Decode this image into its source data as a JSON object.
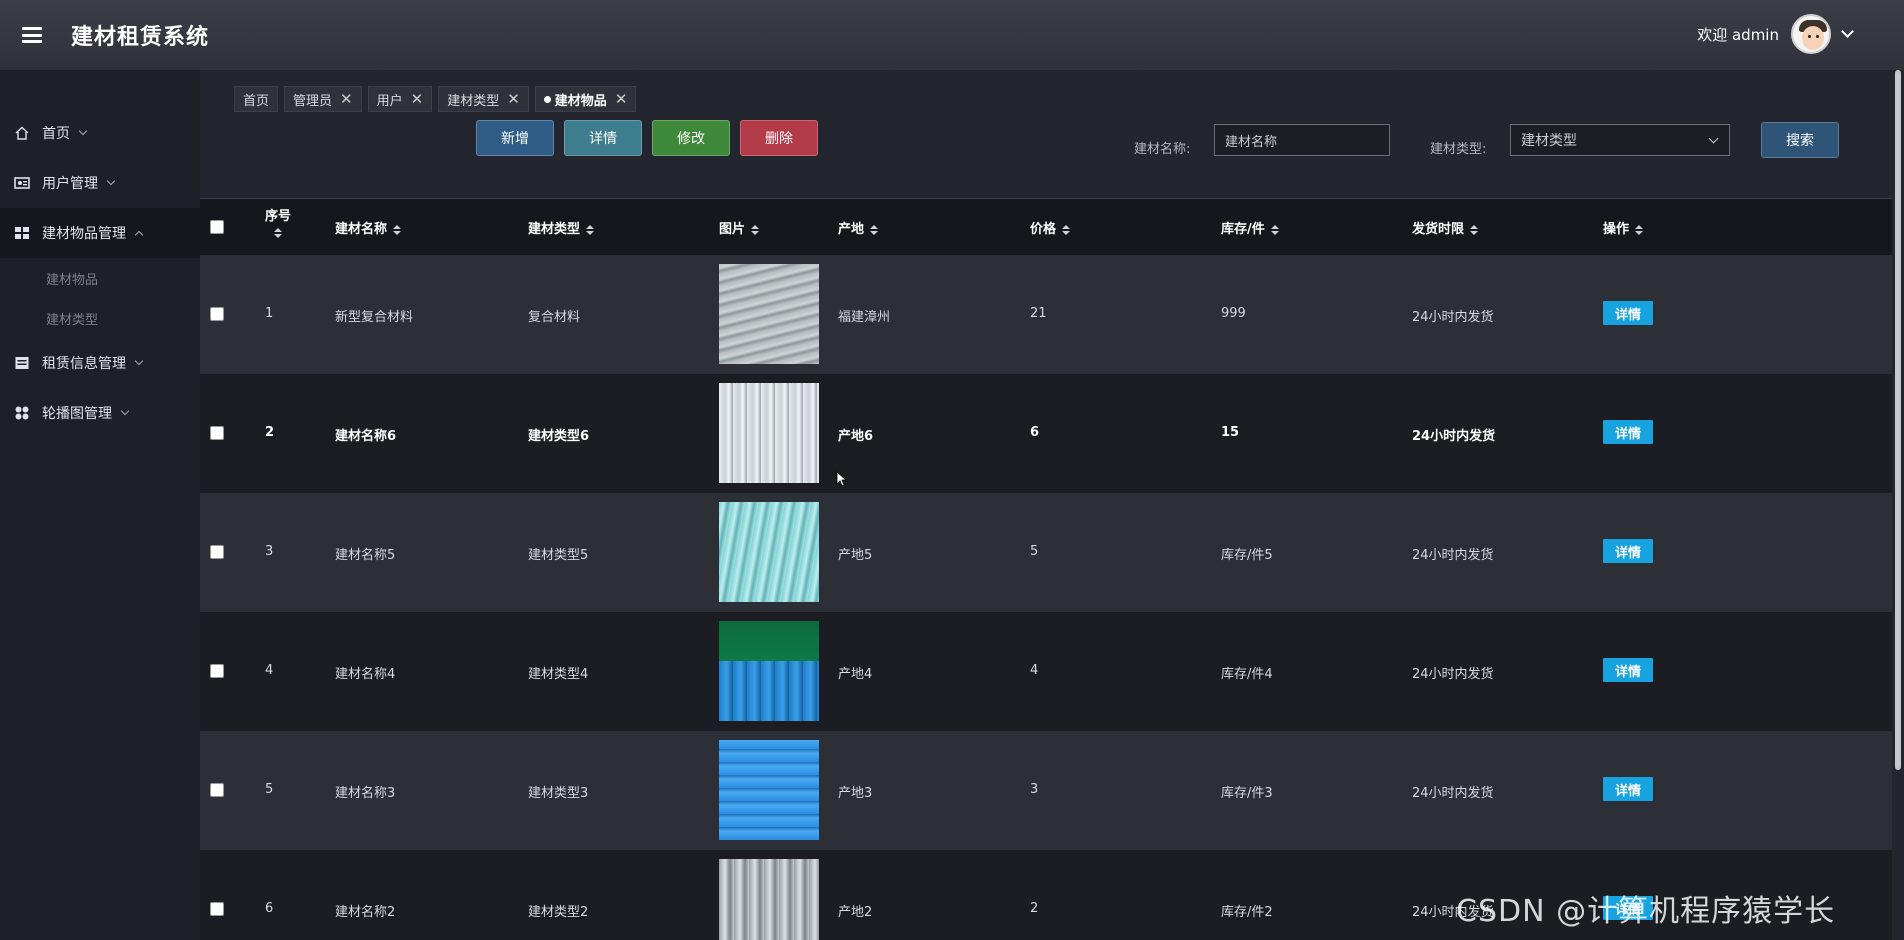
{
  "app": {
    "title": "建材租赁系统"
  },
  "user": {
    "welcome": "欢迎 admin"
  },
  "sidebar": {
    "items": [
      {
        "label": "首页",
        "icon": "home-icon"
      },
      {
        "label": "用户管理",
        "icon": "id-card-icon"
      },
      {
        "label": "建材物品管理",
        "icon": "grid-icon",
        "expanded": true,
        "children": [
          {
            "label": "建材物品"
          },
          {
            "label": "建材类型"
          }
        ]
      },
      {
        "label": "租赁信息管理",
        "icon": "document-icon"
      },
      {
        "label": "轮播图管理",
        "icon": "apps-icon"
      }
    ]
  },
  "tabs": [
    {
      "label": "首页"
    },
    {
      "label": "管理员"
    },
    {
      "label": "用户"
    },
    {
      "label": "建材类型"
    },
    {
      "label": "建材物品"
    }
  ],
  "toolbar": {
    "add": "新增",
    "detail": "详情",
    "edit": "修改",
    "delete": "删除"
  },
  "search": {
    "name_label": "建材名称:",
    "name_placeholder": "建材名称",
    "type_label": "建材类型:",
    "type_placeholder": "建材类型",
    "button": "搜索"
  },
  "table": {
    "columns": [
      "序号",
      "建材名称",
      "建材类型",
      "图片",
      "产地",
      "价格",
      "库存/件",
      "发货时限",
      "操作"
    ],
    "rows": [
      {
        "no": "1",
        "name": "新型复合材料",
        "type": "复合材料",
        "origin": "福建漳州",
        "price": "21",
        "stock": "999",
        "delivery": "24小时内发货",
        "action": "详情"
      },
      {
        "no": "2",
        "name": "建材名称6",
        "type": "建材类型6",
        "origin": "产地6",
        "price": "6",
        "stock": "15",
        "delivery": "24小时内发货",
        "action": "详情"
      },
      {
        "no": "3",
        "name": "建材名称5",
        "type": "建材类型5",
        "origin": "产地5",
        "price": "5",
        "stock": "库存/件5",
        "delivery": "24小时内发货",
        "action": "详情"
      },
      {
        "no": "4",
        "name": "建材名称4",
        "type": "建材类型4",
        "origin": "产地4",
        "price": "4",
        "stock": "库存/件4",
        "delivery": "24小时内发货",
        "action": "详情"
      },
      {
        "no": "5",
        "name": "建材名称3",
        "type": "建材类型3",
        "origin": "产地3",
        "price": "3",
        "stock": "库存/件3",
        "delivery": "24小时内发货",
        "action": "详情"
      },
      {
        "no": "6",
        "name": "建材名称2",
        "type": "建材类型2",
        "origin": "产地2",
        "price": "2",
        "stock": "库存/件2",
        "delivery": "24小时内发货",
        "action": "详情"
      }
    ]
  },
  "watermark": "CSDN @计算机程序猿学长",
  "colors": {
    "accent": "#17a2e0",
    "add": "#2f5d88",
    "detail": "#3d7d8d",
    "edit": "#3f8a3a",
    "delete": "#b33a47"
  }
}
